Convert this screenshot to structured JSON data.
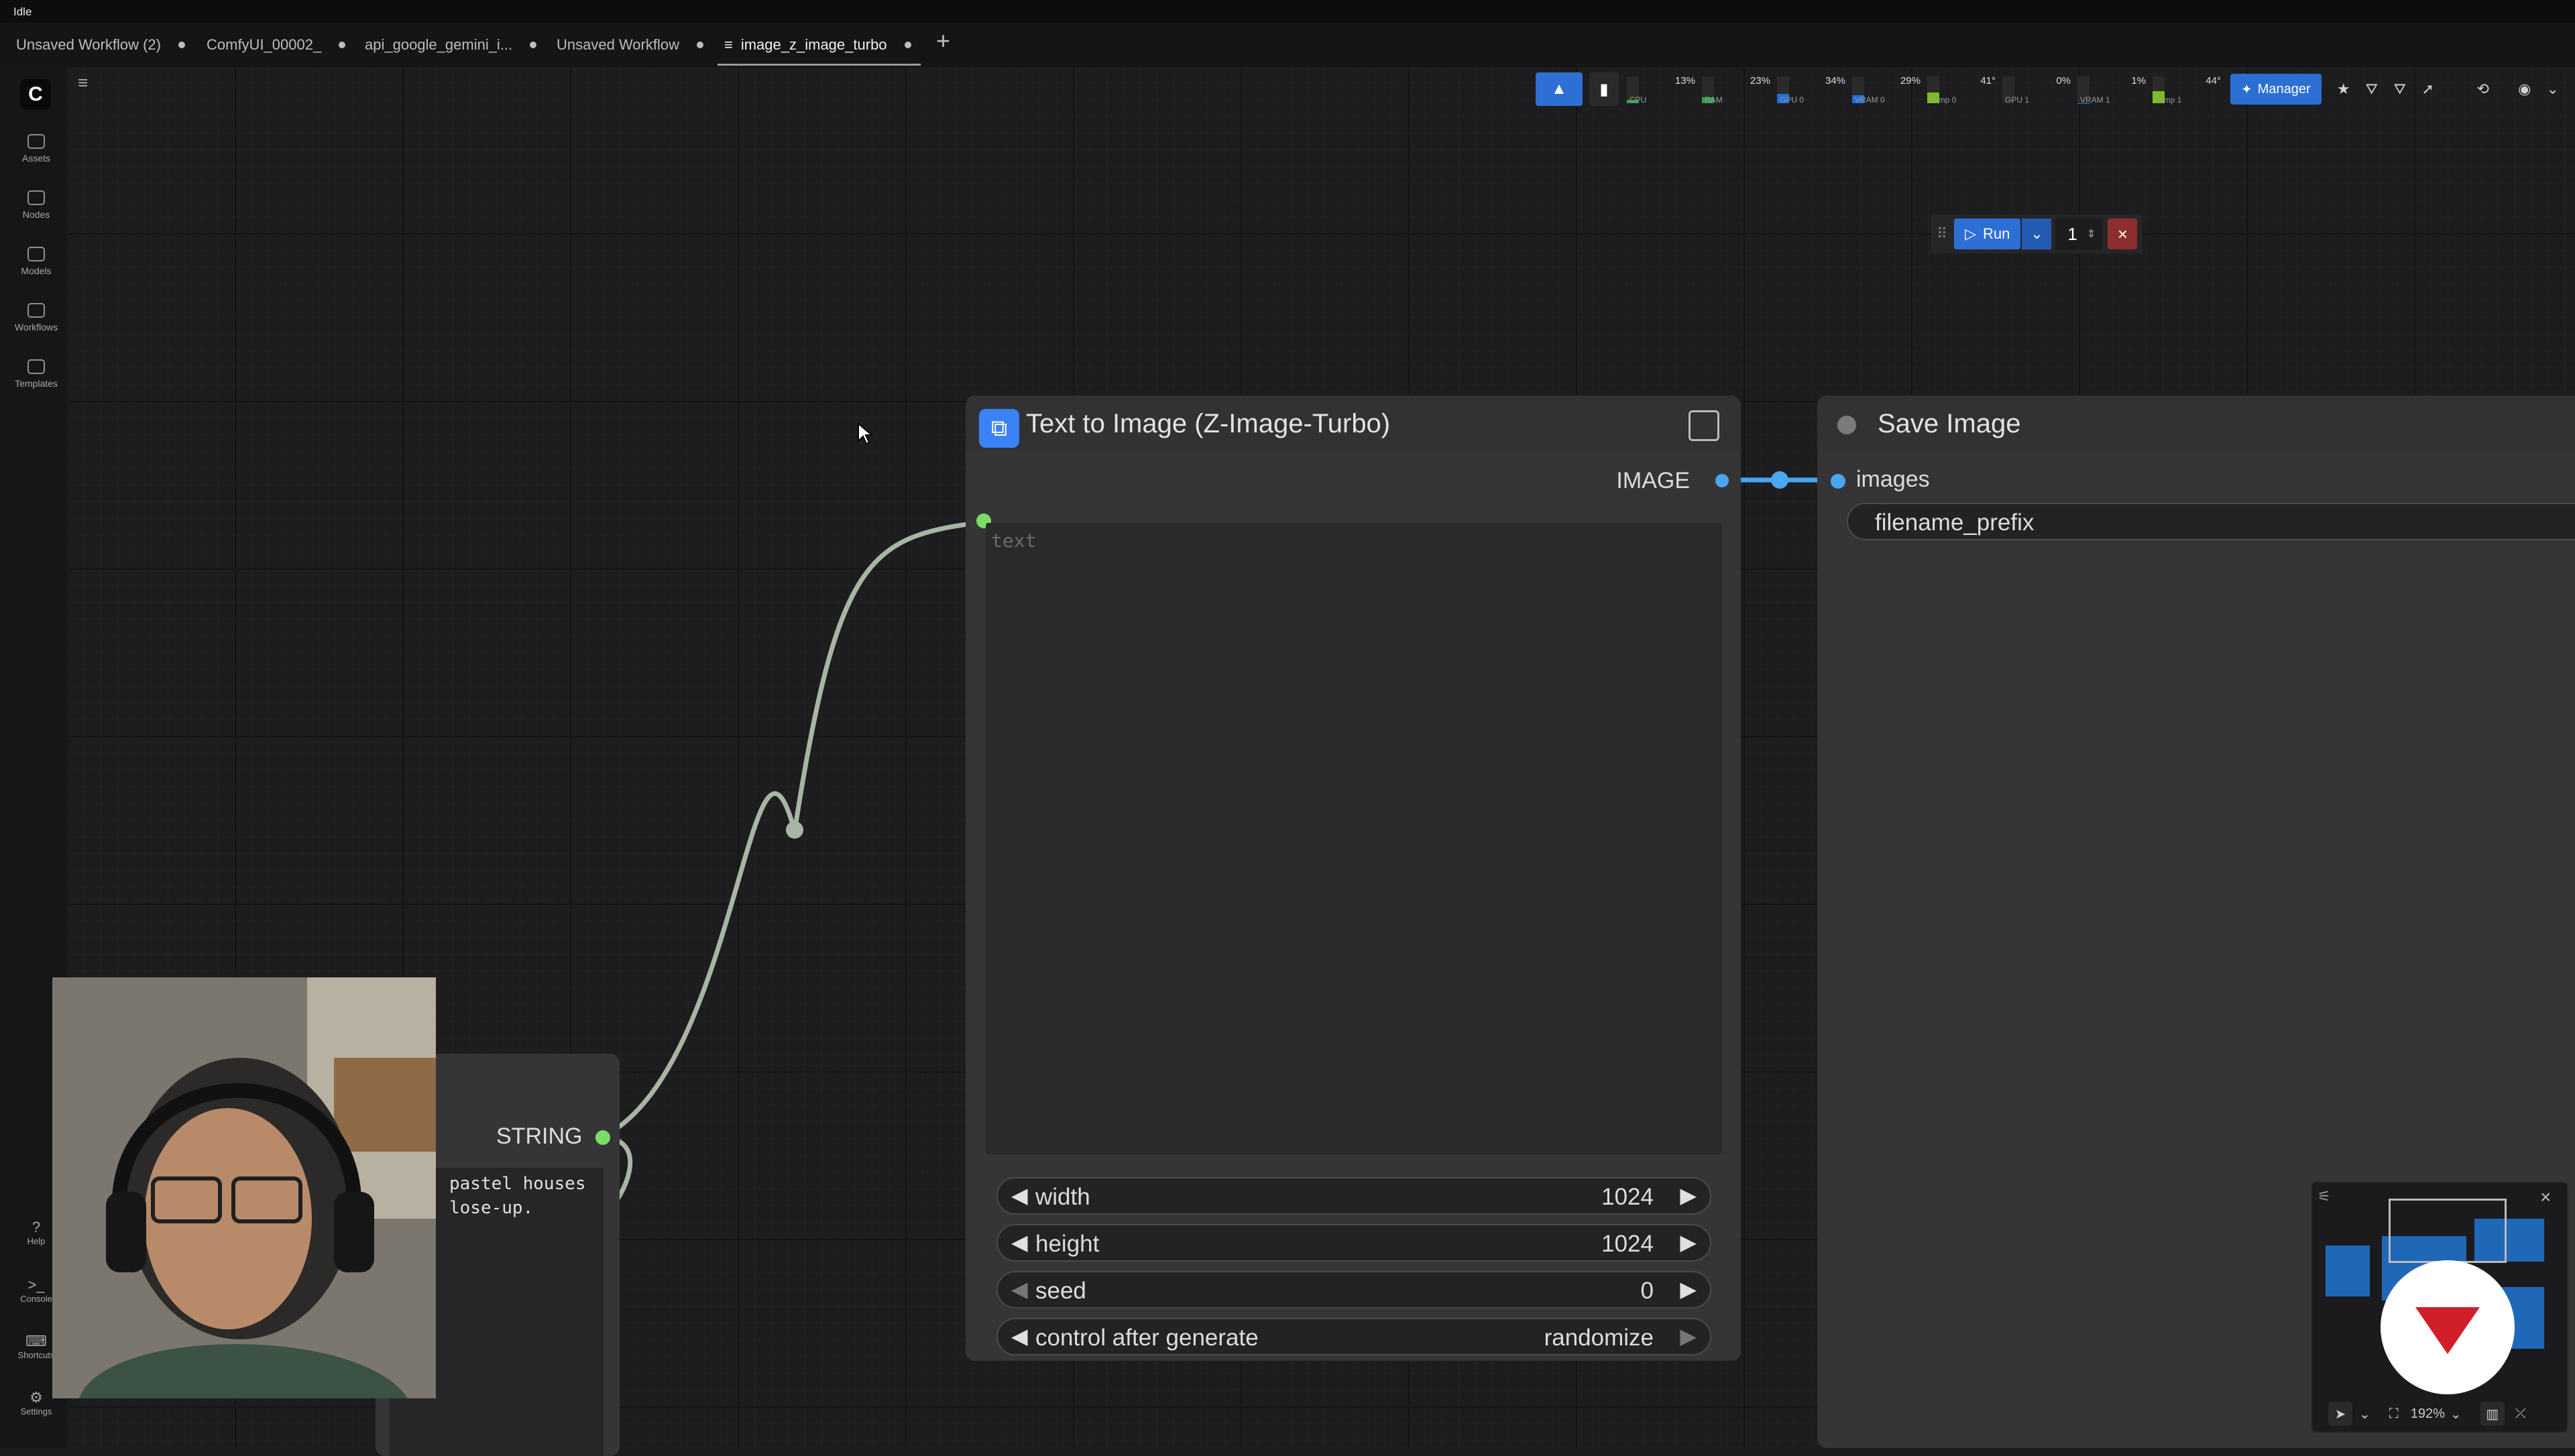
{
  "window": {
    "status": "Idle"
  },
  "tabs": [
    {
      "label": "Unsaved Workflow (2)"
    },
    {
      "label": "ComfyUI_00002_"
    },
    {
      "label": "api_google_gemini_i..."
    },
    {
      "label": "Unsaved Workflow"
    },
    {
      "label": "image_z_image_turbo"
    }
  ],
  "sidebar": {
    "items": [
      {
        "label": "Assets"
      },
      {
        "label": "Nodes"
      },
      {
        "label": "Models"
      },
      {
        "label": "Workflows"
      },
      {
        "label": "Templates"
      }
    ],
    "bottom": [
      {
        "label": "Help"
      },
      {
        "label": "Console"
      },
      {
        "label": "Shortcuts"
      },
      {
        "label": "Settings"
      }
    ]
  },
  "status": {
    "cpu": {
      "label": "CPU",
      "value": "13%",
      "level": 0.13,
      "color": "#2f9e44"
    },
    "ram": {
      "label": "RAM",
      "value": "23%",
      "level": 0.23,
      "color": "#2f9e44"
    },
    "gpu0": {
      "label": "GPU 0",
      "value": "34%",
      "level": 0.34,
      "color": "#1f6fd6"
    },
    "vram0": {
      "label": "VRAM 0",
      "value": "29%",
      "level": 0.29,
      "color": "#1f6fd6"
    },
    "temp0": {
      "label": "Temp 0",
      "value": "41°",
      "level": 0.41,
      "color": "#7bbf1e"
    },
    "gpu1": {
      "label": "GPU 1",
      "value": "0%",
      "level": 0.0,
      "color": "#1f6fd6"
    },
    "vram1": {
      "label": "VRAM 1",
      "value": "1%",
      "level": 0.01,
      "color": "#1f6fd6"
    },
    "temp1": {
      "label": "Temp 1",
      "value": "44°",
      "level": 0.44,
      "color": "#7bbf1e"
    },
    "manager_label": "Manager"
  },
  "run": {
    "label": "Run",
    "count": "1"
  },
  "text_to_image_node": {
    "title": "Text to Image (Z-Image-Turbo)",
    "output_label": "IMAGE",
    "text_placeholder": "text",
    "widgets": [
      {
        "name": "width",
        "value": "1024"
      },
      {
        "name": "height",
        "value": "1024"
      },
      {
        "name": "seed",
        "value": "0"
      },
      {
        "name": "control after generate",
        "value": "randomize"
      }
    ]
  },
  "save_image_node": {
    "title": "Save Image",
    "input_label": "images",
    "widget_label": "filename_prefix"
  },
  "string_node": {
    "output_label": "STRING",
    "text": "pastel houses\nlose-up."
  },
  "minimap": {
    "zoom": "192%"
  },
  "colors": {
    "accent": "#2e6fd6",
    "link_green": "#7ddc64",
    "link_blue": "#4aa6f0",
    "cancel": "#8d2d2d"
  }
}
